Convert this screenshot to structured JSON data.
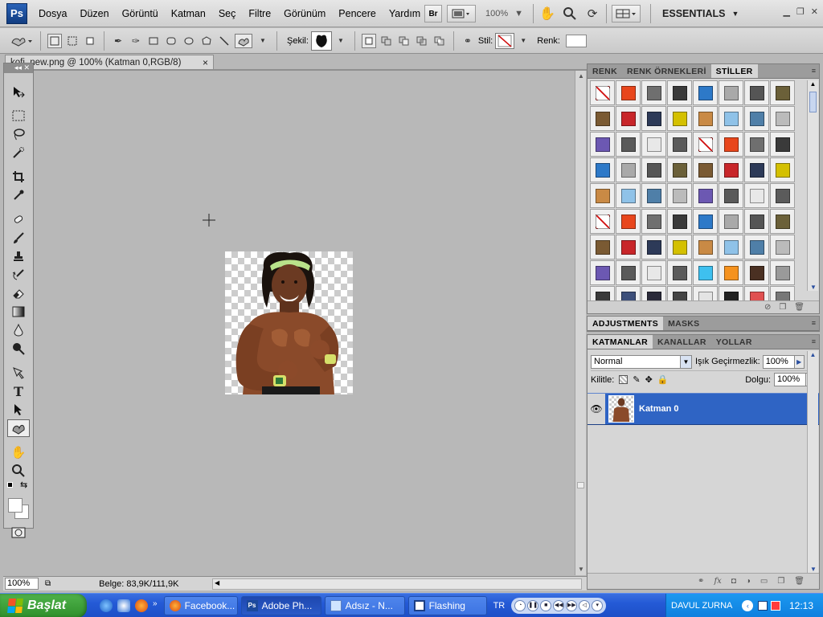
{
  "app": {
    "logo": "Ps"
  },
  "menu": [
    "Dosya",
    "Düzen",
    "Görüntü",
    "Katman",
    "Seç",
    "Filtre",
    "Görünüm",
    "Pencere",
    "Yardım"
  ],
  "appbar": {
    "bridge": "Br",
    "zoom": "100%",
    "workspace": "ESSENTIALS"
  },
  "options": {
    "shape_label": "Şekil:",
    "style_label": "Stil:",
    "color_label": "Renk:"
  },
  "document": {
    "tab_title": "kofi_new.png @ 100% (Katman 0,RGB/8)",
    "close": "×"
  },
  "status": {
    "zoom": "100%",
    "info": "Belge: 83,9K/111,9K"
  },
  "panels": {
    "top_tabs": [
      "RENK",
      "RENK ÖRNEKLERİ",
      "STİLLER"
    ],
    "mid_tabs": [
      "ADJUSTMENTS",
      "MASKS"
    ],
    "layer_tabs": [
      "KATMANLAR",
      "KANALLAR",
      "YOLLAR"
    ]
  },
  "styles_colors": [
    "#ffffff",
    "#e8461c",
    "#6f6f6f",
    "#3a3a3a",
    "#2d79c8",
    "#a9a9a9",
    "#555555",
    "#6b6039",
    "#7a5a33",
    "#c8262a",
    "#2d3a58",
    "#d4c000",
    "#c98a45",
    "#8fc2e8",
    "#4f7fa8",
    "#bbbbbb",
    "#6c58b2",
    "#5a5a5a",
    "#e8e8e8",
    "#5b5b5b",
    "#ffffff",
    "#e8461c",
    "#6f6f6f",
    "#3a3a3a",
    "#2d79c8",
    "#a9a9a9",
    "#555555",
    "#6b6039",
    "#7a5a33",
    "#c8262a",
    "#2d3a58",
    "#d4c000",
    "#c98a45",
    "#8fc2e8",
    "#4f7fa8",
    "#bbbbbb",
    "#6c58b2",
    "#5a5a5a",
    "#e8e8e8",
    "#5b5b5b",
    "#ffffff",
    "#e8461c",
    "#6f6f6f",
    "#3a3a3a",
    "#2d79c8",
    "#a9a9a9",
    "#555555",
    "#6b6039",
    "#7a5a33",
    "#c8262a",
    "#2d3a58",
    "#d4c000",
    "#c98a45",
    "#8fc2e8",
    "#4f7fa8",
    "#bbbbbb",
    "#6c58b2",
    "#5a5a5a",
    "#e8e8e8",
    "#5b5b5b",
    "#3ec0ef",
    "#f5921e",
    "#4a3022",
    "#9a9a9a",
    "#3a3a3a",
    "#3d4f7a",
    "#2a2a3a",
    "#444444",
    "#e4e4e4",
    "#222222",
    "#e05050",
    "#777777"
  ],
  "layers": {
    "blend_mode": "Normal",
    "opacity_label": "Işık Geçirmezlik:",
    "opacity": "100%",
    "lock_label": "Kilitle:",
    "fill_label": "Dolgu:",
    "fill": "100%",
    "items": [
      {
        "name": "Katman 0"
      }
    ]
  },
  "taskbar": {
    "start": "Başlat",
    "tasks": [
      "Facebook...",
      "Adobe Ph...",
      "Adsız - N...",
      "Flashing"
    ],
    "lang": "TR",
    "tray_text": "DAVUL ZURNA",
    "clock": "12:13"
  }
}
